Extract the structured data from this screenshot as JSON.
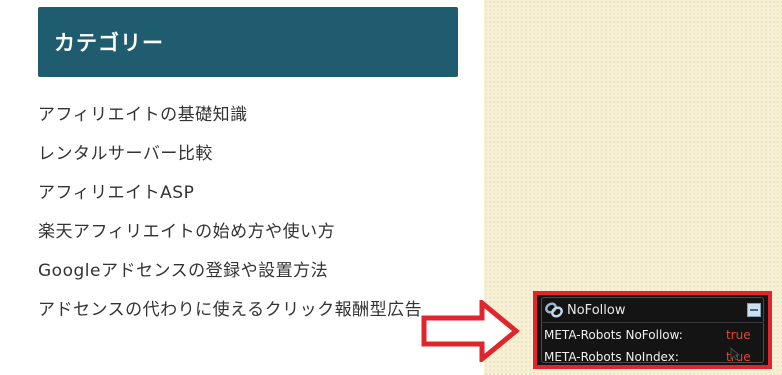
{
  "sidebar": {
    "title": "カテゴリー",
    "items": [
      {
        "label": "アフィリエイトの基礎知識"
      },
      {
        "label": "レンタルサーバー比較"
      },
      {
        "label": "アフィリエイトASP"
      },
      {
        "label": "楽天アフィリエイトの始め方や使い方"
      },
      {
        "label": "Googleアドセンスの登録や設置方法"
      },
      {
        "label": "アドセンスの代わりに使えるクリック報酬型広告"
      }
    ]
  },
  "panel": {
    "title": "NoFollow",
    "rows": [
      {
        "label": "META-Robots NoFollow:",
        "value": "true"
      },
      {
        "label": "META-Robots NoIndex:",
        "value": "true"
      }
    ],
    "icon": "chain-link-icon",
    "collapse_icon": "minimize-icon"
  },
  "colors": {
    "header_bg": "#1f5c6f",
    "highlight_border": "#e0262c",
    "arrow": "#e0262c",
    "true_value": "#e8442c",
    "panel_bg": "#141414"
  }
}
